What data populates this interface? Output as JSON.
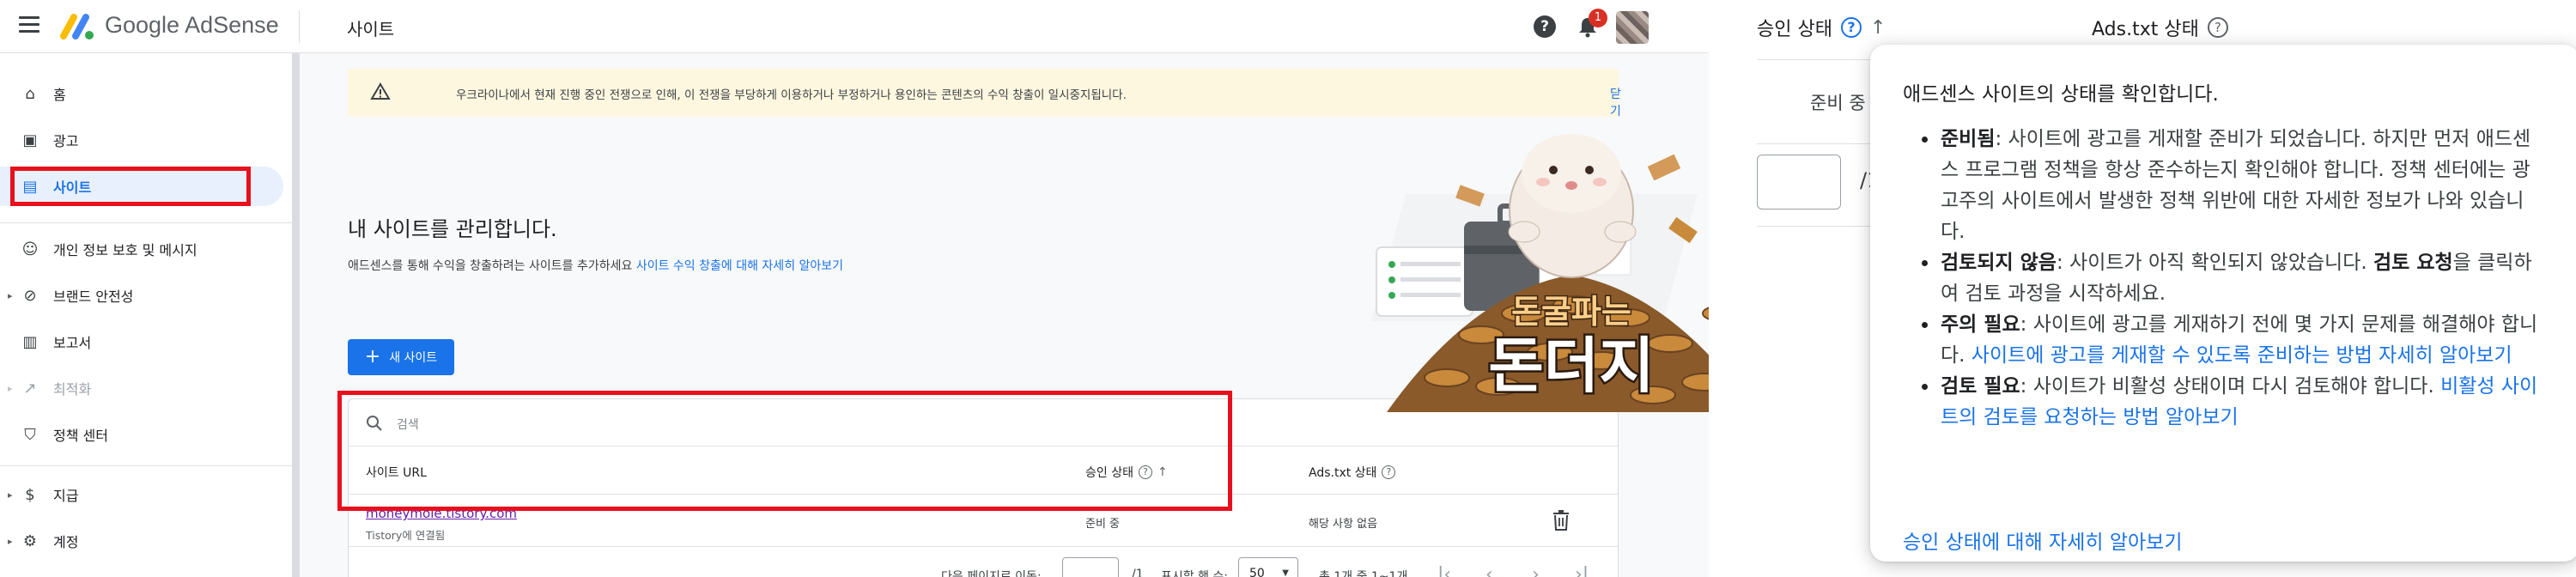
{
  "app": {
    "brand": "Google AdSense",
    "page_title": "사이트",
    "notification_count": "1"
  },
  "sidebar": {
    "items": [
      {
        "label": "홈",
        "icon": "home-icon"
      },
      {
        "label": "광고",
        "icon": "ads-icon"
      },
      {
        "label": "사이트",
        "icon": "sites-icon",
        "active": true
      },
      {
        "label": "개인 정보 보호 및 메시지",
        "icon": "privacy-icon"
      },
      {
        "label": "브랜드 안전성",
        "icon": "brand-safety-icon"
      },
      {
        "label": "보고서",
        "icon": "reports-icon"
      },
      {
        "label": "최적화",
        "icon": "optimization-icon",
        "disabled": true
      },
      {
        "label": "정책 센터",
        "icon": "policy-center-icon"
      },
      {
        "label": "지급",
        "icon": "payments-icon"
      },
      {
        "label": "계정",
        "icon": "account-gear-icon"
      }
    ]
  },
  "banner": {
    "text": "우크라이나에서 현재 진행 중인 전쟁으로 인해, 이 전쟁을 부당하게 이용하거나 부정하거나 용인하는 콘텐츠의 수익 창출이 일시중지됩니다.",
    "close_label": "닫기"
  },
  "sites": {
    "heading": "내 사이트를 관리합니다.",
    "subtext": "애드센스를 통해 수익을 창출하려는 사이트를 추가하세요",
    "sub_link": "사이트 수익 창출에 대해 자세히 알아보기",
    "new_site_label": "새 사이트",
    "search_placeholder": "검색",
    "columns": {
      "url": "사이트 URL",
      "approval": "승인 상태",
      "adstxt": "Ads.txt 상태"
    },
    "rows": [
      {
        "url": "moneymole.tistory.com",
        "note": "Tistory에 연결됨",
        "approval": "준비 중",
        "adstxt": "해당 사항 없음"
      }
    ],
    "pager": {
      "goto_label": "다음 페이지로 이동:",
      "page_total": "/1",
      "rows_label": "표시할 행 수:",
      "rows_value": "50",
      "range": "총 1개 중 1~1개"
    }
  },
  "overlay": {
    "line1": "돈굴파는",
    "line2": "돈더지"
  },
  "zoom_panel": {
    "approval_header": "승인 상태",
    "adstxt_header": "Ads.txt 상태",
    "state": "준비 중",
    "page_total": "/1"
  },
  "tooltip": {
    "intro": "애드센스 사이트의 상태를 확인합니다.",
    "items": [
      {
        "term": "준비됨",
        "text": ": 사이트에 광고를 게재할 준비가 되었습니다. 하지만 먼저 애드센스 프로그램 정책을 항상 준수하는지 확인해야 합니다. 정책 센터에는 광고주의 사이트에서 발생한 정책 위반에 대한 자세한 정보가 나와 있습니다."
      },
      {
        "term": "검토되지 않음",
        "text": ": 사이트가 아직 확인되지 않았습니다.",
        "term2": "검토 요청",
        "text2": "을 클릭하여 검토 과정을 시작하세요."
      },
      {
        "term": "주의 필요",
        "text": ": 사이트에 광고를 게재하기 전에 몇 가지 문제를 해결해야 합니다.",
        "link": "사이트에 광고를 게재할 수 있도록 준비하는 방법 자세히 알아보기"
      },
      {
        "term": "검토 필요",
        "text": ": 사이트가 비활성 상태이며 다시 검토해야 합니다.",
        "link": "비활성 사이트의 검토를 요청하는 방법 알아보기"
      }
    ],
    "footer_link": "승인 상태에 대해 자세히 알아보기"
  },
  "colors": {
    "accent": "#1a73e8",
    "highlight_box": "#e8101c",
    "banner_bg": "#fef7e0",
    "visited_link": "#681da8"
  }
}
